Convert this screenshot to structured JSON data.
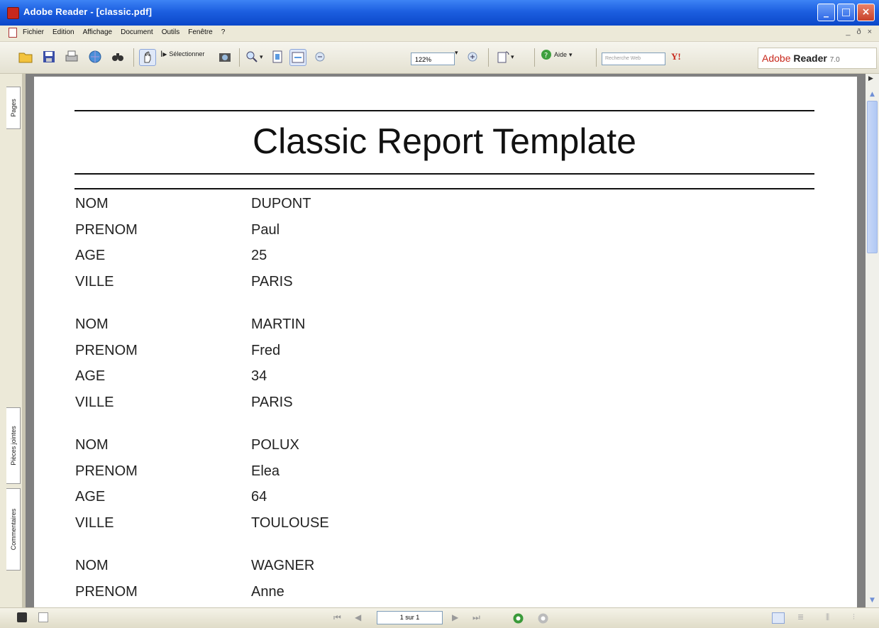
{
  "window": {
    "title": "Adobe Reader - [classic.pdf]",
    "controls": {
      "minimize": "_",
      "maximize": "□",
      "close": "×"
    }
  },
  "menu": {
    "items": [
      "Fichier",
      "Edition",
      "Affichage",
      "Document",
      "Outils",
      "Fenêtre",
      "?"
    ],
    "mdi_controls": [
      "_",
      "ð",
      "×"
    ]
  },
  "toolbar": {
    "select_label": "Sélectionner",
    "zoom_value": "122%",
    "help_label": "Aide",
    "search_placeholder": "Recherche Web",
    "yahoo_label": "Y!",
    "brand": {
      "adobe": "Adobe",
      "reader": "Reader",
      "version": "7.0"
    }
  },
  "side_tabs": [
    "Pages",
    "Pièces jointes",
    "Commentaires"
  ],
  "document": {
    "title": "Classic Report Template",
    "records": [
      {
        "rows": [
          {
            "label": "NOM",
            "value": "DUPONT"
          },
          {
            "label": "PRENOM",
            "value": "Paul"
          },
          {
            "label": "AGE",
            "value": "25"
          },
          {
            "label": "VILLE",
            "value": "PARIS"
          }
        ]
      },
      {
        "rows": [
          {
            "label": "NOM",
            "value": "MARTIN"
          },
          {
            "label": "PRENOM",
            "value": "Fred"
          },
          {
            "label": "AGE",
            "value": "34"
          },
          {
            "label": "VILLE",
            "value": "PARIS"
          }
        ]
      },
      {
        "rows": [
          {
            "label": "NOM",
            "value": "POLUX"
          },
          {
            "label": "PRENOM",
            "value": "Elea"
          },
          {
            "label": "AGE",
            "value": "64"
          },
          {
            "label": "VILLE",
            "value": "TOULOUSE"
          }
        ]
      },
      {
        "rows": [
          {
            "label": "NOM",
            "value": "WAGNER"
          },
          {
            "label": "PRENOM",
            "value": "Anne"
          }
        ]
      }
    ]
  },
  "statusbar": {
    "page_indicator": "1 sur 1",
    "nav": {
      "first": "⏮",
      "prev": "◀",
      "next": "▶",
      "last": "⏭"
    }
  },
  "colors": {
    "titlebar": "#1c5fe0",
    "adobe_red": "#c8281c",
    "page_bg": "#ffffff",
    "view_bg": "#808080"
  }
}
